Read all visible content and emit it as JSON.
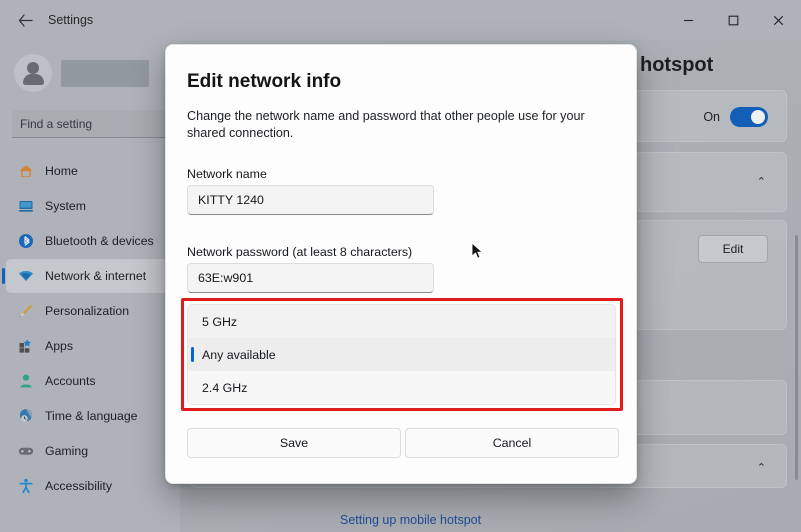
{
  "window": {
    "title": "Settings",
    "back_icon": "back-arrow-icon",
    "minimize_label": "–",
    "maximize_label": "☐",
    "close_label": "✕"
  },
  "sidebar": {
    "profile": {
      "avatar_icon": "user-avatar-icon",
      "name": ""
    },
    "search": {
      "placeholder": "Find a setting",
      "icon": "search-icon"
    },
    "items": [
      {
        "label": "Home",
        "icon": "home-icon",
        "active": false
      },
      {
        "label": "System",
        "icon": "system-icon",
        "active": false
      },
      {
        "label": "Bluetooth & devices",
        "icon": "bluetooth-icon",
        "active": false
      },
      {
        "label": "Network & internet",
        "icon": "wifi-icon",
        "active": true
      },
      {
        "label": "Personalization",
        "icon": "brush-icon",
        "active": false
      },
      {
        "label": "Apps",
        "icon": "apps-icon",
        "active": false
      },
      {
        "label": "Accounts",
        "icon": "accounts-icon",
        "active": false
      },
      {
        "label": "Time & language",
        "icon": "clock-icon",
        "active": false
      },
      {
        "label": "Gaming",
        "icon": "gamepad-icon",
        "active": false
      },
      {
        "label": "Accessibility",
        "icon": "accessibility-icon",
        "active": false
      }
    ]
  },
  "main": {
    "page_title": "hotspot",
    "hotspot_toggle": {
      "label": "On",
      "state": "on"
    },
    "expand_icon_1": "⌃",
    "expand_icon_2": "⌃",
    "edit_button": "Edit",
    "help_link": "Setting up mobile hotspot"
  },
  "dialog": {
    "title": "Edit network info",
    "description": "Change the network name and password that other people use for your shared connection.",
    "fields": [
      {
        "label": "Network name",
        "value": "KITTY 1240"
      },
      {
        "label": "Network password (at least 8 characters)",
        "value": "63E:w901"
      }
    ],
    "band_dropdown": {
      "highlight_color": "#e01b1b",
      "selected": "Any available",
      "options": [
        {
          "label": "5 GHz",
          "selected": false
        },
        {
          "label": "Any available",
          "selected": true
        },
        {
          "label": "2.4 GHz",
          "selected": false
        }
      ]
    },
    "save_label": "Save",
    "cancel_label": "Cancel"
  },
  "colors": {
    "accent": "#0a5fc0",
    "highlight": "#e01b1b",
    "link": "#1b4aa0"
  }
}
